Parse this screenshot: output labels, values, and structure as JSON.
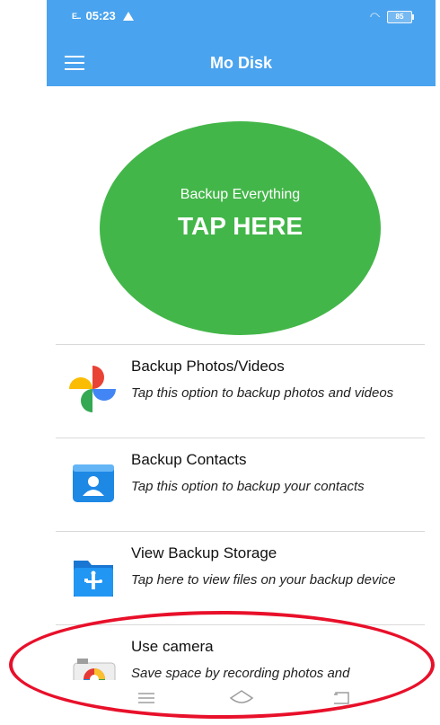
{
  "status_bar": {
    "signal": "E...",
    "time": "05:23",
    "battery": "85"
  },
  "app_bar": {
    "title": "Mo Disk"
  },
  "backup_button": {
    "subtitle": "Backup Everything",
    "label": "TAP HERE",
    "color": "#43b649"
  },
  "list": {
    "items": [
      {
        "title": "Backup Photos/Videos",
        "description": "Tap this option to backup photos and videos",
        "icon": "google-photos-icon"
      },
      {
        "title": "Backup Contacts",
        "description": "Tap this option to backup your contacts",
        "icon": "contacts-icon"
      },
      {
        "title": "View Backup Storage",
        "description": "Tap here to view files on your backup device",
        "icon": "usb-folder-icon"
      },
      {
        "title": "Use camera",
        "description": "Save space by recording photos and",
        "icon": "camera-icon"
      }
    ]
  },
  "colors": {
    "app_bar": "#4aa3ee",
    "annotation": "#e8102a"
  }
}
